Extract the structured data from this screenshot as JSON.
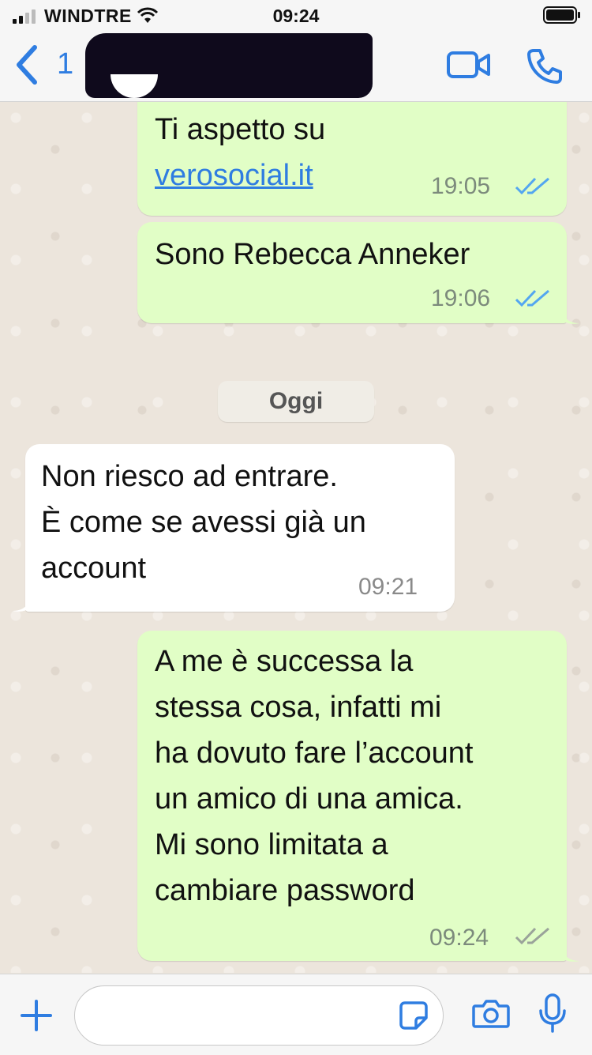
{
  "status_bar": {
    "carrier": "WINDTRE",
    "time": "09:24"
  },
  "nav": {
    "unread_count": "1"
  },
  "messages": [
    {
      "direction": "outgoing",
      "line1": "Ti aspetto su",
      "link": "verosocial.it",
      "time": "19:05",
      "status": "read"
    },
    {
      "direction": "outgoing",
      "text": "Sono Rebecca Anneker",
      "time": "19:06",
      "status": "read"
    },
    {
      "direction": "incoming",
      "lines": [
        "Non riesco ad entrare.",
        "È come se avessi già un",
        "account"
      ],
      "time": "09:21"
    },
    {
      "direction": "outgoing",
      "lines": [
        "A me è successa la",
        "stessa cosa, infatti mi",
        "ha dovuto fare l’account",
        "un amico di una amica.",
        "Mi sono limitata a",
        "cambiare password"
      ],
      "time": "09:24",
      "status": "delivered"
    }
  ],
  "day_separator": "Oggi",
  "colors": {
    "accent": "#2f7de1",
    "outgoing_bubble": "#e1fec6",
    "incoming_bubble": "#ffffff",
    "read_ticks": "#53a6f0",
    "delivered_ticks": "#9aa39a"
  },
  "icons": [
    "signal-icon",
    "wifi-icon",
    "battery-icon",
    "back-chevron-icon",
    "video-call-icon",
    "phone-icon",
    "plus-icon",
    "sticker-icon",
    "camera-icon",
    "microphone-icon"
  ]
}
